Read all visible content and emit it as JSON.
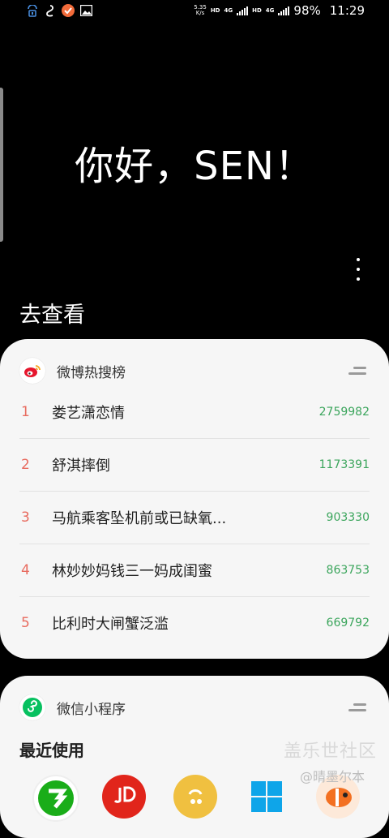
{
  "status_bar": {
    "net_speed_value": "5.35",
    "net_speed_unit": "K/s",
    "hd1": "HD",
    "lte1": "4G",
    "hd2": "HD",
    "lte2": "4G",
    "battery": "98%",
    "time": "11:29",
    "left_icons": [
      "lock-wifi-icon",
      "tentacle-icon",
      "orange-app-icon",
      "gallery-icon"
    ]
  },
  "greeting": "你好，SEN！",
  "section_title": "去查看",
  "weibo_card": {
    "title": "微博热搜榜",
    "items": [
      {
        "rank": "1",
        "topic": "娄艺潇恋情",
        "count": "2759982"
      },
      {
        "rank": "2",
        "topic": "舒淇摔倒",
        "count": "1173391"
      },
      {
        "rank": "3",
        "topic": "马航乘客坠机前或已缺氧...",
        "count": "903330"
      },
      {
        "rank": "4",
        "topic": "林妙妙妈钱三一妈成闺蜜",
        "count": "863753"
      },
      {
        "rank": "5",
        "topic": "比利时大闸蟹泛滥",
        "count": "669792"
      }
    ],
    "colors": {
      "rank": "#e86b5f",
      "count": "#3ba55c"
    }
  },
  "wechat_card": {
    "title": "微信小程序",
    "recent_label": "最近使用",
    "apps": [
      "green-app-icon",
      "jd-app-icon",
      "yellow-app-icon",
      "windows-app-icon",
      "clownfish-app-icon"
    ]
  },
  "watermark": {
    "line1": "盖乐世社区",
    "line2": "@晴墨尔本"
  }
}
